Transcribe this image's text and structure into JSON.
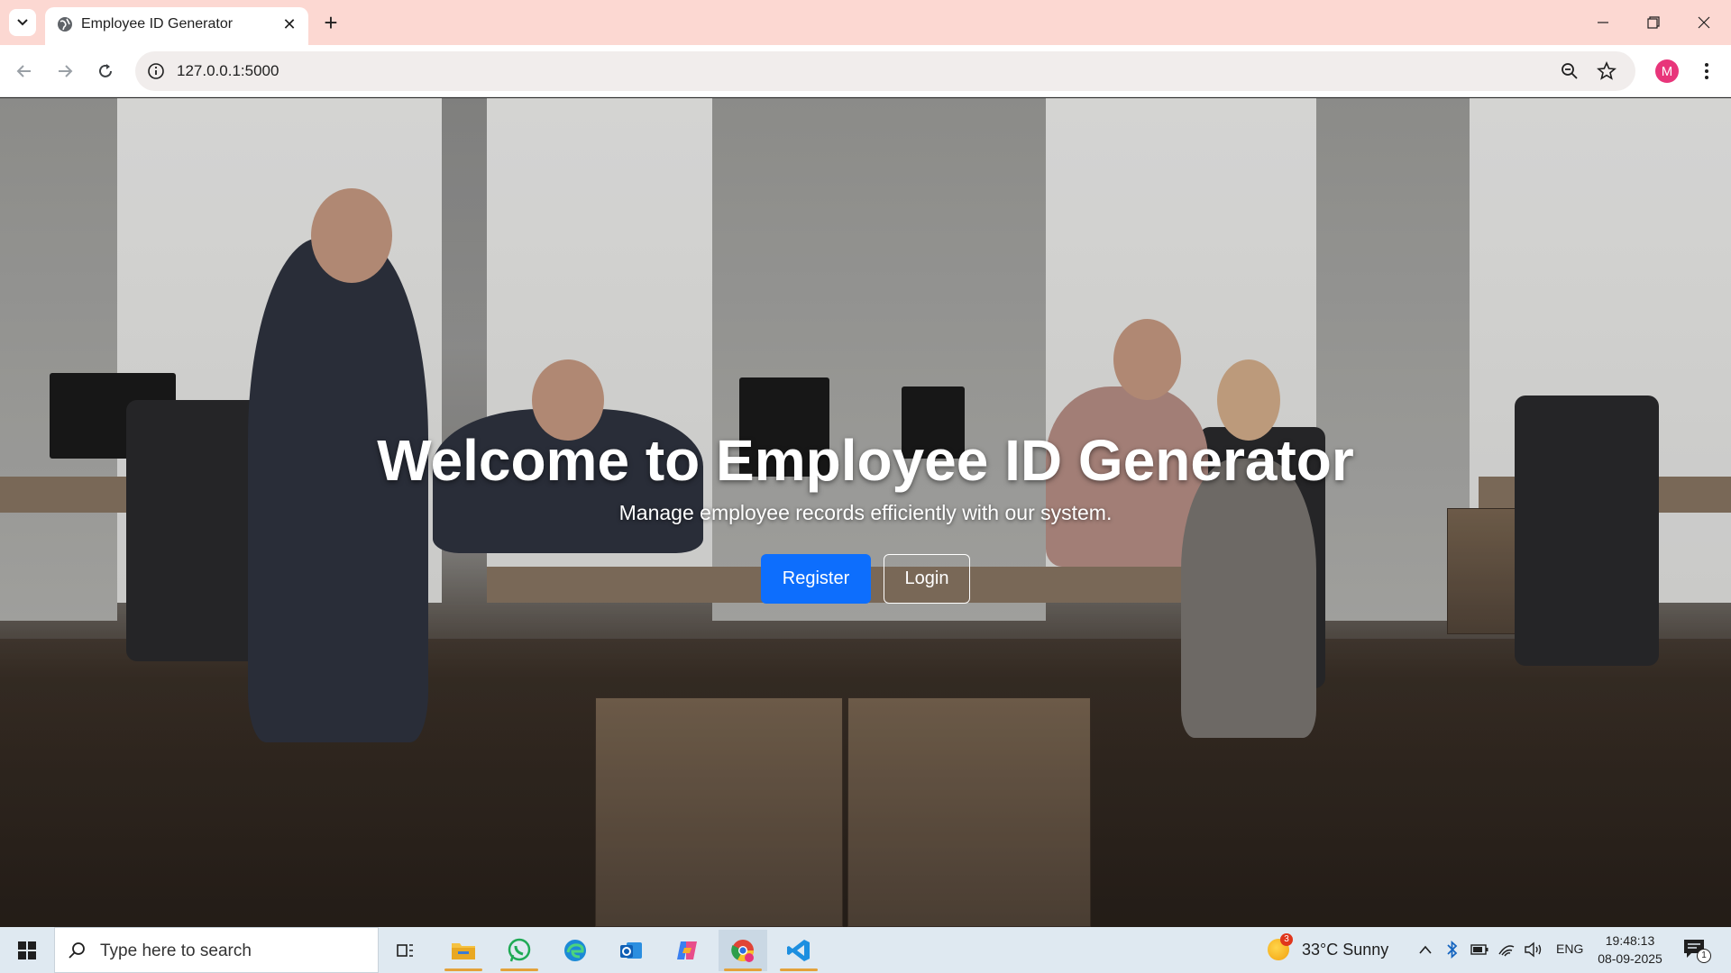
{
  "browser": {
    "tab_title": "Employee ID Generator",
    "tab_close_glyph": "✕",
    "new_tab_glyph": "+",
    "url": "127.0.0.1:5000",
    "profile_initial": "M"
  },
  "hero": {
    "title": "Welcome to Employee ID Generator",
    "subtitle": "Manage employee records efficiently with our system.",
    "register_label": "Register",
    "login_label": "Login"
  },
  "taskbar": {
    "search_placeholder": "Type here to search",
    "weather_text": "33°C  Sunny",
    "weather_badge": "3",
    "language": "ENG",
    "time": "19:48:13",
    "date": "08-09-2025",
    "notification_count": "1",
    "apps": [
      "task-view-icon",
      "file-explorer-icon",
      "whatsapp-icon",
      "edge-icon",
      "outlook-icon",
      "copilot-icon",
      "chrome-icon",
      "vscode-icon"
    ]
  },
  "colors": {
    "tabstrip": "#fcd8d2",
    "primary_button": "#0d6efd",
    "taskbar": "#dfe9f1",
    "avatar": "#e8357a"
  }
}
